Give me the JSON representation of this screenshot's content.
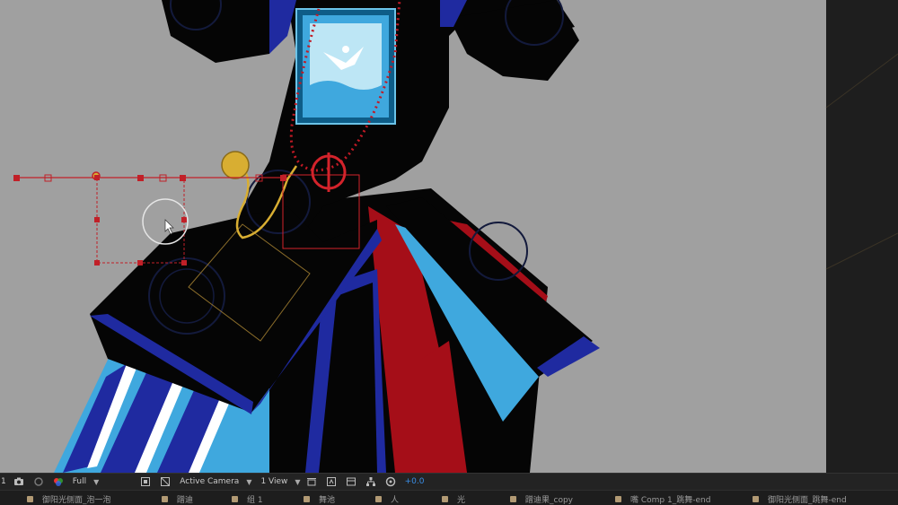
{
  "toolbar": {
    "frame_number": "1",
    "resolution": "Full",
    "camera": "Active Camera",
    "view": "1 View",
    "exposure": "+0.0"
  },
  "layers": [
    {
      "name": "御阳光侧面_泡一泡"
    },
    {
      "name": "蹭迪"
    },
    {
      "name": "组 1"
    },
    {
      "name": "舞池"
    },
    {
      "name": "人"
    },
    {
      "name": "光"
    },
    {
      "name": "蹭迪果_copy"
    },
    {
      "name": "嘴 Comp 1_跳舞-end"
    },
    {
      "name": "御阳光侧面_跳舞-end"
    }
  ],
  "colors": {
    "canvas_bg": "#a0a0a0",
    "robe": "#050505",
    "blue": "#1f2aa0",
    "sky": "#3fa8de",
    "red": "#a50e18",
    "gold": "#d8ae32",
    "selection_red": "#d3232b",
    "accent_blue": "#3a8ee6"
  }
}
